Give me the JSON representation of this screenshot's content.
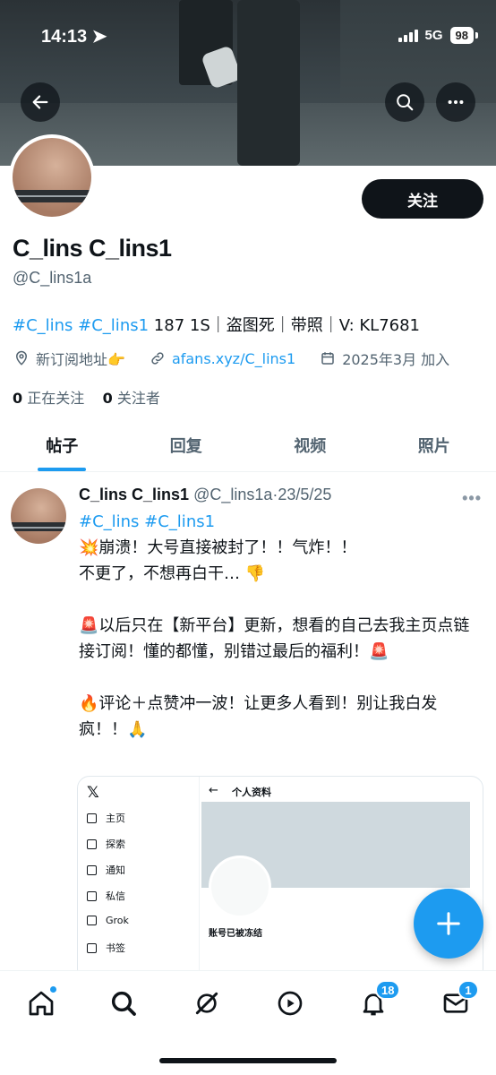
{
  "status_bar": {
    "time": "14:13",
    "network": "5G",
    "battery": "98"
  },
  "profile": {
    "follow_label": "关注",
    "display_name": "C_lins C_lins1",
    "handle": "@C_lins1a",
    "bio_tags": "#C_lins #C_lins1",
    "bio_text": " 187 1S｜盗图死｜带照｜V: KL7681",
    "location": "新订阅地址👉",
    "link": "afans.xyz/C_lins1",
    "joined": "2025年3月 加入",
    "following_count": "0",
    "following_label": "正在关注",
    "followers_count": "0",
    "followers_label": "关注者"
  },
  "tabs": [
    {
      "label": "帖子",
      "active": true
    },
    {
      "label": "回复",
      "active": false
    },
    {
      "label": "视频",
      "active": false
    },
    {
      "label": "照片",
      "active": false
    }
  ],
  "post": {
    "author_name": "C_lins C_lins1",
    "author_handle": "@C_lins1a",
    "date": "23/5/25",
    "tags": "#C_lins #C_lins1",
    "line1": "💥崩溃！大号直接被封了！！气炸！！",
    "line2": "不更了，不想再白干… 👎",
    "para2": "🚨以后只在【新平台】更新，想看的自己去我主页点链接订阅！懂的都懂，别错过最后的福利！🚨",
    "para3": "🔥评论＋点赞冲一波！让更多人看到！别让我白发疯！！🙏"
  },
  "embedded_screenshot": {
    "logo": "𝕏",
    "nav_items": [
      "主页",
      "探索",
      "通知",
      "私信",
      "Grok",
      "书签"
    ],
    "back": "←",
    "title": "个人资料",
    "status": "账号已被冻结"
  },
  "bottom_nav": {
    "notifications_badge": "18",
    "messages_badge": "1"
  },
  "colors": {
    "accent": "#1d9bf0",
    "text": "#0f1419",
    "muted": "#536471"
  }
}
